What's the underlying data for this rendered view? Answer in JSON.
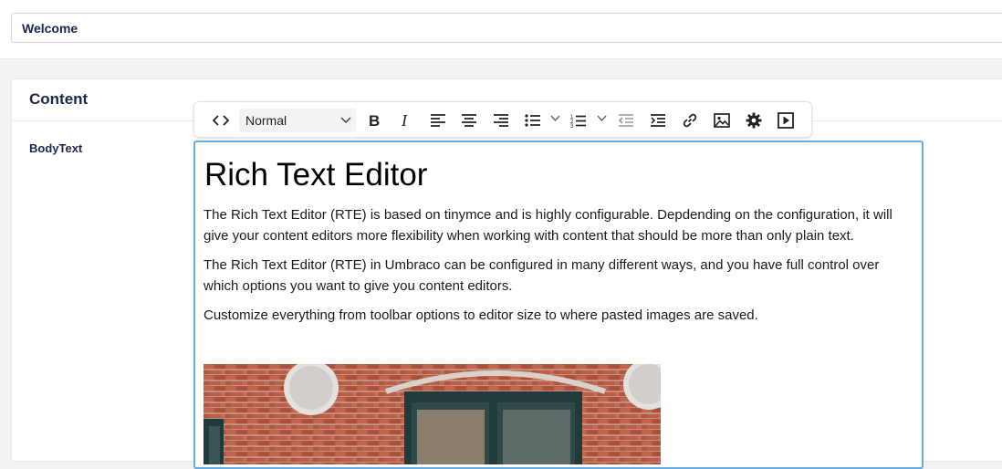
{
  "node_name": {
    "value": "Welcome"
  },
  "content_group": {
    "title": "Content"
  },
  "property": {
    "label": "BodyText"
  },
  "toolbar": {
    "buttons": [
      {
        "name": "source-code-icon"
      },
      {
        "name": "bold-icon"
      },
      {
        "name": "italic-icon"
      },
      {
        "name": "align-left-icon"
      },
      {
        "name": "align-center-icon"
      },
      {
        "name": "align-right-icon"
      },
      {
        "name": "bullet-list-icon"
      },
      {
        "name": "numbered-list-icon"
      },
      {
        "name": "outdent-icon"
      },
      {
        "name": "indent-icon"
      },
      {
        "name": "link-icon"
      },
      {
        "name": "image-icon"
      },
      {
        "name": "settings-icon"
      },
      {
        "name": "media-icon"
      }
    ],
    "format_value": "Normal"
  },
  "editor": {
    "heading": "Rich Text Editor",
    "paragraphs": [
      "The Rich Text Editor (RTE) is based on tinymce and is highly configurable. Depdending on the configuration, it will give your content editors more flexibility when working with content that should be more than only plain text.",
      "The Rich Text Editor (RTE) in Umbraco can be configured in many different ways, and you have full control over which options you want to give you content editors.",
      "Customize everything from toolbar options to editor size to where pasted images are saved."
    ]
  },
  "colors": {
    "text": "#1b264f",
    "focus_border": "#68abe0",
    "background": "#f3f3f5"
  }
}
